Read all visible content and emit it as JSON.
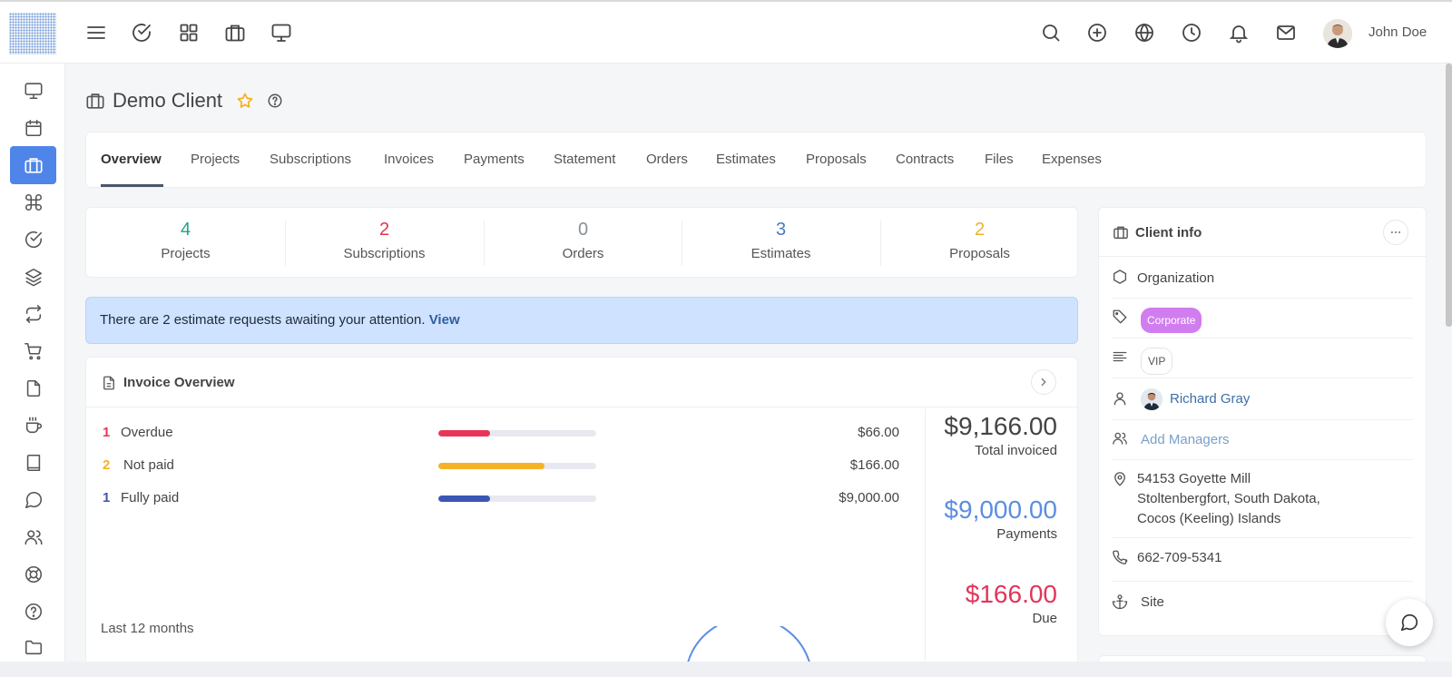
{
  "header": {
    "user_name": "John Doe",
    "left_icons": [
      "menu-icon",
      "check-circle-icon",
      "grid-icon",
      "briefcase-icon",
      "monitor-icon"
    ],
    "right_icons": [
      "search-icon",
      "plus-circle-icon",
      "globe-icon",
      "clock-icon",
      "bell-icon",
      "mail-icon"
    ]
  },
  "sidebar": {
    "items": [
      "monitor-icon",
      "calendar-icon",
      "briefcase-icon",
      "command-icon",
      "check-circle-icon",
      "layers-icon",
      "repeat-icon",
      "cart-icon",
      "file-icon",
      "coffee-icon",
      "book-icon",
      "message-circle-icon",
      "users-icon",
      "lifebuoy-icon",
      "help-circle-icon",
      "folder-icon"
    ],
    "active": "briefcase-icon"
  },
  "page": {
    "title": "Demo Client"
  },
  "tabs": [
    "Overview",
    "Projects",
    "Subscriptions",
    "Invoices",
    "Payments",
    "Statement",
    "Orders",
    "Estimates",
    "Proposals",
    "Contracts",
    "Files",
    "Expenses"
  ],
  "stats": [
    {
      "value": "4",
      "label": "Projects",
      "color": "#1fa38a"
    },
    {
      "value": "2",
      "label": "Subscriptions",
      "color": "#e0364f"
    },
    {
      "value": "0",
      "label": "Orders",
      "color": "#8a8f98"
    },
    {
      "value": "3",
      "label": "Estimates",
      "color": "#4a78c7"
    },
    {
      "value": "2",
      "label": "Proposals",
      "color": "#efb12a"
    }
  ],
  "alert": {
    "text": "There are 2 estimate requests awaiting your attention.",
    "link": "View"
  },
  "invoice_overview": {
    "title": "Invoice Overview",
    "rows": [
      {
        "count": "1",
        "label": "Overdue",
        "amount": "$66.00",
        "progress": 0.33,
        "color": "#e8365a"
      },
      {
        "count": "2",
        "label": "Not paid",
        "amount": "$166.00",
        "progress": 0.67,
        "color": "#f4b326"
      },
      {
        "count": "1",
        "label": "Fully paid",
        "amount": "$9,000.00",
        "progress": 0.33,
        "color": "#3b57b5"
      }
    ],
    "totals": [
      {
        "value": "$9,166.00",
        "caption": "Total invoiced",
        "color": "#444444"
      },
      {
        "value": "$9,000.00",
        "caption": "Payments",
        "color": "#5b8de3"
      },
      {
        "value": "$166.00",
        "caption": "Due",
        "color": "#e0365a"
      }
    ],
    "period": "Last 12 months"
  },
  "client_info": {
    "title": "Client info",
    "type": "Organization",
    "labels": [
      "Corporate",
      "VIP"
    ],
    "contact": "Richard Gray",
    "add_managers": "Add Managers",
    "address": [
      "54153 Goyette Mill",
      "Stoltenbergfort, South Dakota,",
      "Cocos (Keeling) Islands"
    ],
    "phone": "662-709-5341",
    "site": "Site"
  }
}
